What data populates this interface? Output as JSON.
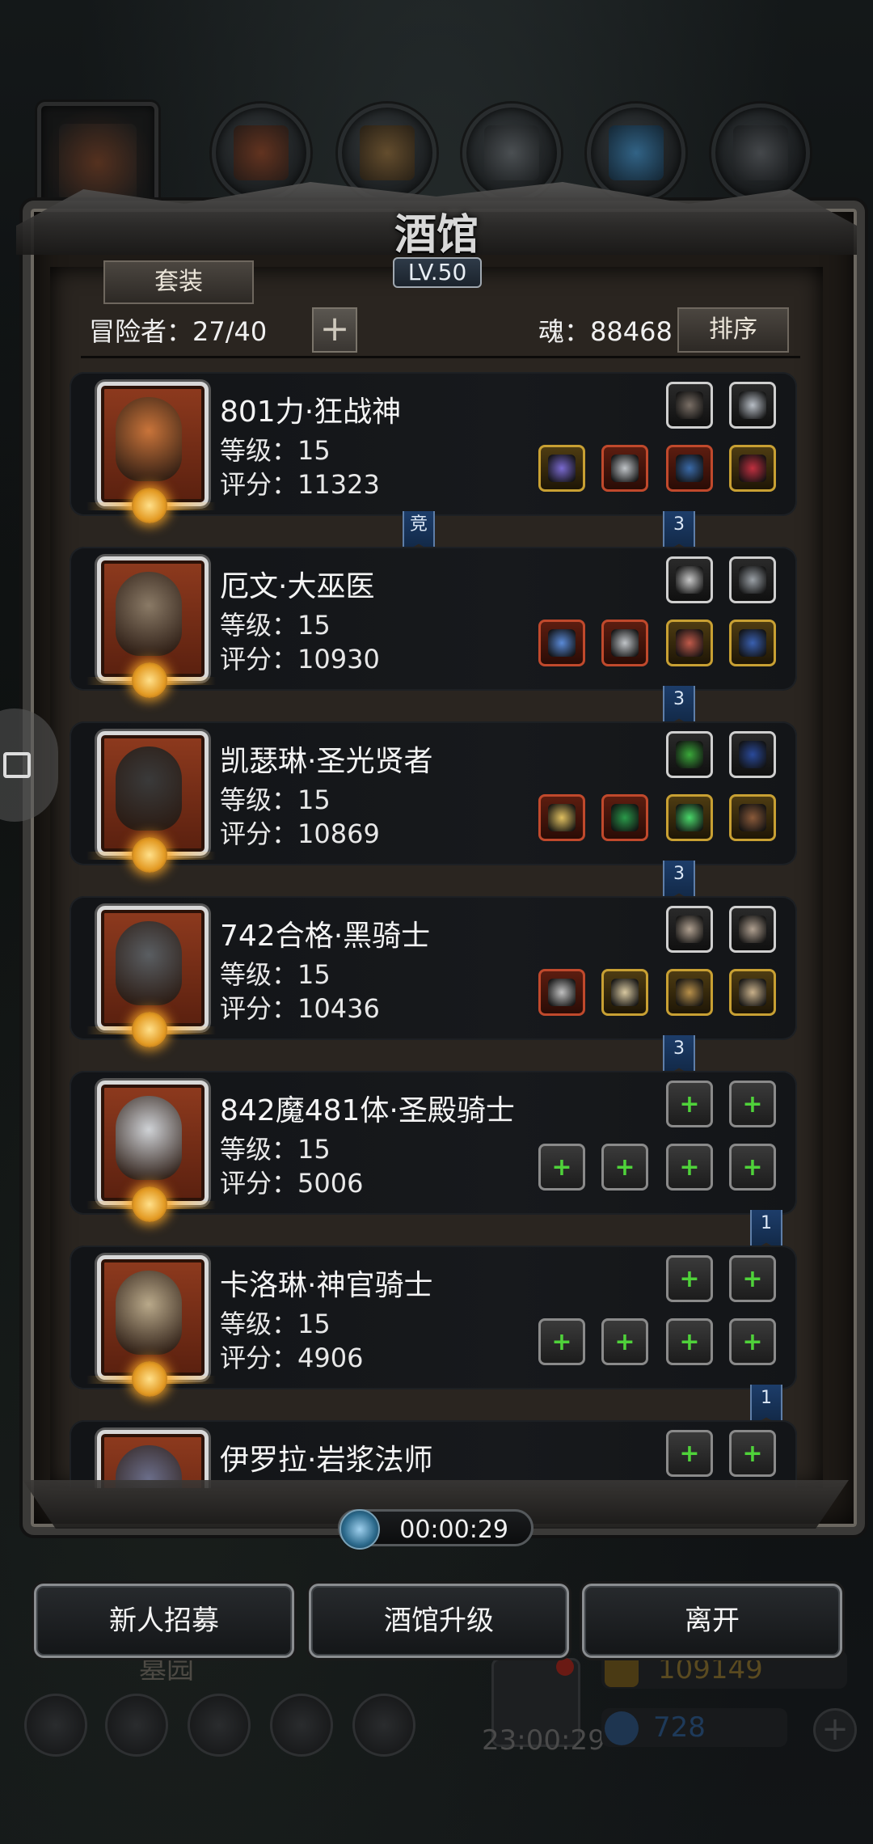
{
  "window": {
    "title": "酒馆",
    "level": "LV.50"
  },
  "toolbar": {
    "set_label": "套装",
    "adventurer_label": "冒险者：27/40",
    "add_label": "+",
    "soul_label": "魂：88468",
    "sort_label": "排序"
  },
  "heroes": [
    {
      "name": "801力·狂战神",
      "level": "等级：15",
      "score": "评分：11323",
      "portrait_color": "#c9743a",
      "top_slots": [
        {
          "style": "gray",
          "icon": "feather-icon"
        },
        {
          "style": "gray",
          "icon": "helm-emblem-icon"
        }
      ],
      "bottom_slots": [
        {
          "style": "gold",
          "icon": "staff-icon"
        },
        {
          "style": "red",
          "icon": "armor-icon"
        },
        {
          "style": "red",
          "icon": "gauntlet-icon"
        },
        {
          "style": "gold",
          "icon": "ring-icon"
        }
      ],
      "badges": [
        {
          "text": "竞"
        },
        {
          "text": "3"
        }
      ]
    },
    {
      "name": "厄文·大巫医",
      "level": "等级：15",
      "score": "评分：10930",
      "portrait_color": "#8a7a66",
      "top_slots": [
        {
          "style": "gray",
          "icon": "wand-icon"
        },
        {
          "style": "gray",
          "icon": "mask-icon"
        }
      ],
      "bottom_slots": [
        {
          "style": "red",
          "icon": "syringe-icon"
        },
        {
          "style": "red",
          "icon": "armor-icon"
        },
        {
          "style": "gold",
          "icon": "amulet-icon"
        },
        {
          "style": "gold",
          "icon": "shield-icon"
        }
      ],
      "badges": [
        {
          "text": "3"
        }
      ]
    },
    {
      "name": "凯瑟琳·圣光贤者",
      "level": "等级：15",
      "score": "评分：10869",
      "portrait_color": "#3a3a3a",
      "top_slots": [
        {
          "style": "gray",
          "icon": "book-icon"
        },
        {
          "style": "gray",
          "icon": "bow-icon"
        }
      ],
      "bottom_slots": [
        {
          "style": "red",
          "icon": "hammer-icon"
        },
        {
          "style": "red",
          "icon": "vest-icon"
        },
        {
          "style": "gold",
          "icon": "leaf-icon"
        },
        {
          "style": "gold",
          "icon": "cloak-icon"
        }
      ],
      "badges": [
        {
          "text": "3"
        }
      ]
    },
    {
      "name": "742合格·黑骑士",
      "level": "等级：15",
      "score": "评分：10436",
      "portrait_color": "#5a5e62",
      "top_slots": [
        {
          "style": "gray",
          "icon": "crossbow-icon"
        },
        {
          "style": "gray",
          "icon": "crossbow-icon"
        }
      ],
      "bottom_slots": [
        {
          "style": "red",
          "icon": "sword-icon"
        },
        {
          "style": "gold",
          "icon": "crest-icon"
        },
        {
          "style": "gold",
          "icon": "scroll-icon"
        },
        {
          "style": "gold",
          "icon": "skull-mask-icon"
        }
      ],
      "badges": [
        {
          "text": "3"
        }
      ]
    },
    {
      "name": "842魔481体·圣殿骑士",
      "level": "等级：15",
      "score": "评分：5006",
      "portrait_color": "#cfd2d6",
      "top_slots": [
        {
          "style": "empty",
          "icon": "plus-icon"
        },
        {
          "style": "empty",
          "icon": "plus-icon"
        }
      ],
      "bottom_slots": [
        {
          "style": "empty",
          "icon": "plus-icon"
        },
        {
          "style": "empty",
          "icon": "plus-icon"
        },
        {
          "style": "empty",
          "icon": "plus-icon"
        },
        {
          "style": "empty",
          "icon": "plus-icon"
        }
      ],
      "badges": [
        {
          "text": "1"
        }
      ]
    },
    {
      "name": "卡洛琳·神官骑士",
      "level": "等级：15",
      "score": "评分：4906",
      "portrait_color": "#b9a98a",
      "top_slots": [
        {
          "style": "empty",
          "icon": "plus-icon"
        },
        {
          "style": "empty",
          "icon": "plus-icon"
        }
      ],
      "bottom_slots": [
        {
          "style": "empty",
          "icon": "plus-icon"
        },
        {
          "style": "empty",
          "icon": "plus-icon"
        },
        {
          "style": "empty",
          "icon": "plus-icon"
        },
        {
          "style": "empty",
          "icon": "plus-icon"
        }
      ],
      "badges": [
        {
          "text": "1"
        }
      ]
    },
    {
      "name": "伊罗拉·岩浆法师",
      "level": "",
      "score": "",
      "portrait_color": "#6b6e8a",
      "top_slots": [
        {
          "style": "empty",
          "icon": "plus-icon"
        },
        {
          "style": "empty",
          "icon": "plus-icon"
        }
      ],
      "bottom_slots": [],
      "badges": []
    }
  ],
  "timer": {
    "value": "00:00:29"
  },
  "actions": {
    "recruit_label": "新人招募",
    "upgrade_label": "酒馆升级",
    "leave_label": "离开"
  },
  "hud": {
    "location": "墓园",
    "gift_timer": "23:00:29",
    "gold": "109149",
    "gems": "728"
  }
}
